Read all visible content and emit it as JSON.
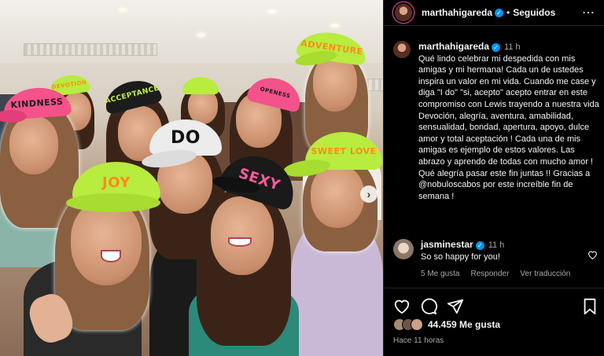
{
  "post": {
    "username": "marthahigareda",
    "follow_status": "Seguidos",
    "caption_time": "11 h",
    "caption": "Qué lindo celebrar mi despedida con mis amigas y mi hermana! Cada un de ustedes inspira un valor en mi vida. Cuando me case y diga \"I do\" \"si, acepto\" acepto entrar en este compromiso con Lewis trayendo a nuestra vida Devoción, alegría, aventura, amabilidad, sensualidad, bondad, apertura, apoyo, dulce amor y total aceptación ! Cada una de mis amigas es ejemplo de estos valores. Las abrazo y aprendo de todas con mucho amor ! Qué alegría pasar este fin juntas !! Gracias a @nobuloscabos por este increíble fin de semana !",
    "likes": "44.459 Me gusta",
    "posted_ago": "Hace 11 horas"
  },
  "comment": {
    "username": "jasminestar",
    "time": "11 h",
    "text": "So so happy for you!",
    "likes": "5 Me gusta",
    "reply": "Responder",
    "translate": "Ver traducción"
  },
  "photo": {
    "cap_texts": [
      "KINDNESS",
      "DEVOTION",
      "ACCEPTANCE",
      "DO",
      "JOY",
      "SEXY",
      "OPENESS",
      "ADVENTURE",
      "SWEET LOVE"
    ]
  },
  "icons": [
    "more-options-icon",
    "verified-icon",
    "heart-icon",
    "comment-icon",
    "share-icon",
    "save-icon",
    "carousel-next-icon"
  ]
}
